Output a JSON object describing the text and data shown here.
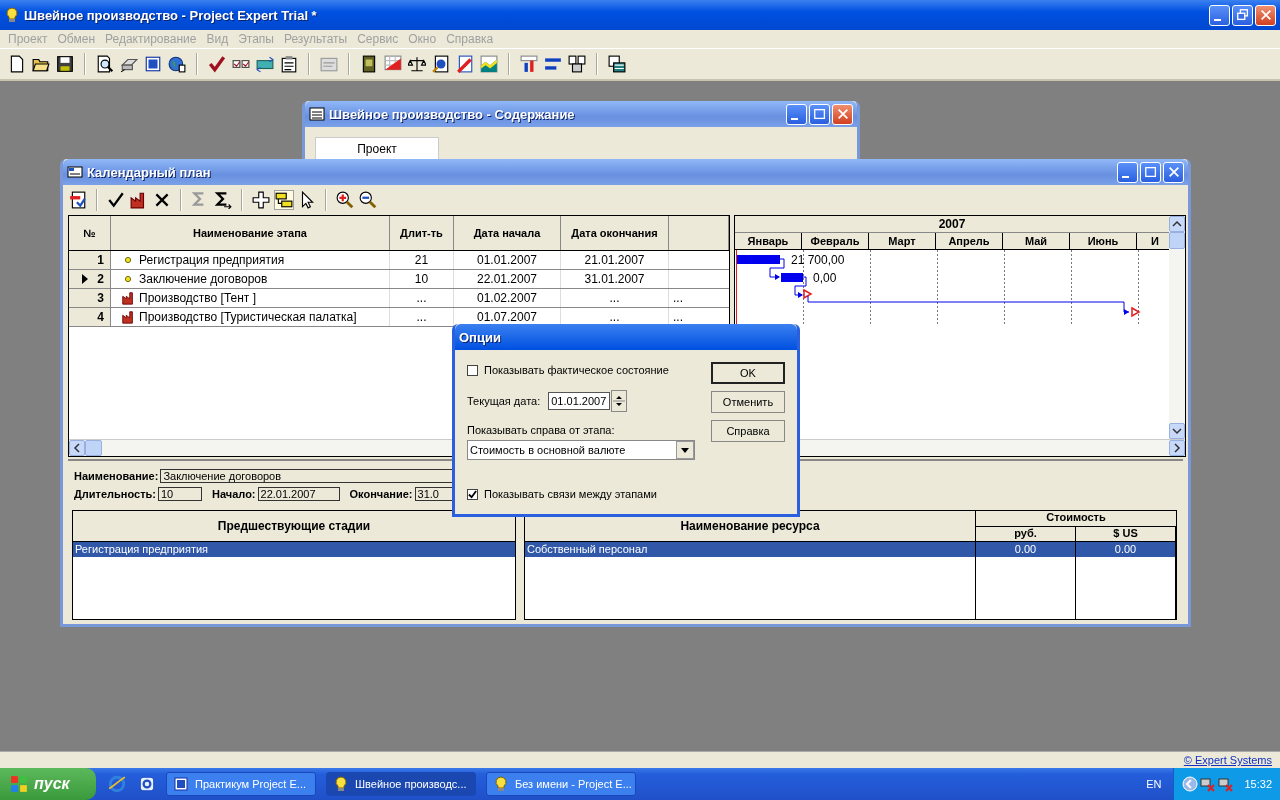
{
  "window": {
    "title": "Швейное производство - Project Expert Trial *"
  },
  "menu": [
    "Проект",
    "Обмен",
    "Редактирование",
    "Вид",
    "Этапы",
    "Результаты",
    "Сервис",
    "Окно",
    "Справка"
  ],
  "content_window": {
    "title": "Швейное производство - Содержание",
    "tab": "Проект"
  },
  "plan_window": {
    "title": "Календарный план",
    "columns": [
      "№",
      "Наименование этапа",
      "Длит-ть",
      "Дата начала",
      "Дата окончания"
    ],
    "rows": [
      {
        "num": "1",
        "name": "Регистрация предприятия",
        "kind": "stage",
        "duration": "21",
        "start": "01.01.2007",
        "end": "21.01.2007",
        "selected": false
      },
      {
        "num": "2",
        "name": "Заключение договоров",
        "kind": "stage",
        "duration": "10",
        "start": "22.01.2007",
        "end": "31.01.2007",
        "selected": true
      },
      {
        "num": "3",
        "name": "Производство [Тент ]",
        "kind": "production",
        "duration": "...",
        "start": "01.02.2007",
        "end": "...",
        "extra": "...",
        "selected": false
      },
      {
        "num": "4",
        "name": "Производство [Туристическая палатка]",
        "kind": "production",
        "duration": "...",
        "start": "01.07.2007",
        "end": "...",
        "extra": "...",
        "selected": false
      }
    ],
    "gantt": {
      "year": "2007",
      "months": [
        "Январь",
        "Февраль",
        "Март",
        "Апрель",
        "Май",
        "Июнь",
        "И"
      ],
      "labels": [
        "21 700,00",
        "0,00"
      ]
    },
    "details": {
      "name_label": "Наименование:",
      "name": "Заключение договоров",
      "duration_label": "Длительность:",
      "duration": "10",
      "start_label": "Начало:",
      "start": "22.01.2007",
      "end_label": "Окончание:",
      "end": "31.0"
    },
    "predecessors": {
      "header": "Предшествующие стадии",
      "rows": [
        {
          "text": "Регистрация предприятия",
          "selected": true
        }
      ]
    },
    "resources": {
      "header": "Наименование ресурса",
      "cost_header": "Стоимость",
      "currencies": [
        "руб.",
        "$ US"
      ],
      "rows": [
        {
          "name": "Собственный персонал",
          "rub": "0.00",
          "usd": "0.00",
          "selected": true
        }
      ]
    }
  },
  "dialog": {
    "title": "Опции",
    "show_actual": {
      "label": "Показывать фактическое состояние",
      "checked": false
    },
    "date_label": "Текущая дата:",
    "date": "01.01.2007",
    "right_label": "Показывать справа от этапа:",
    "right_value": "Стоимость в основной валюте",
    "show_links": {
      "label": "Показывать связи между этапами",
      "checked": true
    },
    "buttons": [
      "OK",
      "Отменить",
      "Справка"
    ]
  },
  "status_bar": {
    "link": "© Expert Systems"
  },
  "taskbar": {
    "start": "пуск",
    "tasks": [
      {
        "label": "Практикум Project E...",
        "kind": "document",
        "selected": false
      },
      {
        "label": "Швейное производс...",
        "kind": "project",
        "selected": true
      },
      {
        "label": "Без имени - Project E...",
        "kind": "project",
        "selected": false
      }
    ],
    "lang": "EN",
    "clock": "15:32"
  }
}
